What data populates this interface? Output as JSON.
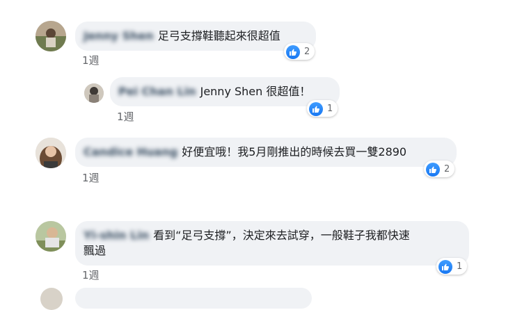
{
  "comments": [
    {
      "author": "Jenny Shen",
      "text": "足弓支撐鞋聽起來很超值",
      "likes": "2",
      "time": "1週"
    },
    {
      "author": "Pei Chan Lin",
      "text": "Jenny Shen 很超值！",
      "likes": "1",
      "time": "1週"
    },
    {
      "author": "Candice Huang",
      "text": "好便宜哦！我5月剛推出的時候去買一雙2890",
      "likes": "2",
      "time": "1週"
    },
    {
      "author": "Yi-shin Lin",
      "text_line1": "看到“足弓支撐”，決定來去試穿，一般鞋子我都快速",
      "text_line2": "飄過",
      "likes": "1",
      "time": "1週"
    }
  ],
  "icons": {
    "reaction": "like-icon"
  },
  "colors": {
    "bubble": "#f0f2f5",
    "like": "#1877f2"
  }
}
